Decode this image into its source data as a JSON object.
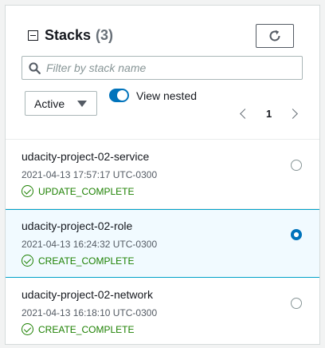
{
  "header": {
    "title": "Stacks",
    "count": "(3)"
  },
  "search": {
    "placeholder": "Filter by stack name",
    "value": ""
  },
  "filter": {
    "selected": "Active"
  },
  "view_nested": {
    "label": "View nested",
    "enabled": true
  },
  "pagination": {
    "current_page": "1"
  },
  "stacks": [
    {
      "name": "udacity-project-02-service",
      "timestamp": "2021-04-13 17:57:17 UTC-0300",
      "status": "UPDATE_COMPLETE",
      "selected": false
    },
    {
      "name": "udacity-project-02-role",
      "timestamp": "2021-04-13 16:24:32 UTC-0300",
      "status": "CREATE_COMPLETE",
      "selected": true
    },
    {
      "name": "udacity-project-02-network",
      "timestamp": "2021-04-13 16:18:10 UTC-0300",
      "status": "CREATE_COMPLETE",
      "selected": false
    }
  ],
  "colors": {
    "accent": "#0073bb",
    "success": "#1d8102",
    "selected_bg": "#f1faff",
    "selected_border": "#00a1c9"
  },
  "icons": {
    "collapse": "collapse-icon",
    "refresh": "refresh-icon",
    "search": "search-icon",
    "caret": "caret-down-icon",
    "prev": "chevron-left-icon",
    "next": "chevron-right-icon",
    "status": "check-circle-icon"
  }
}
